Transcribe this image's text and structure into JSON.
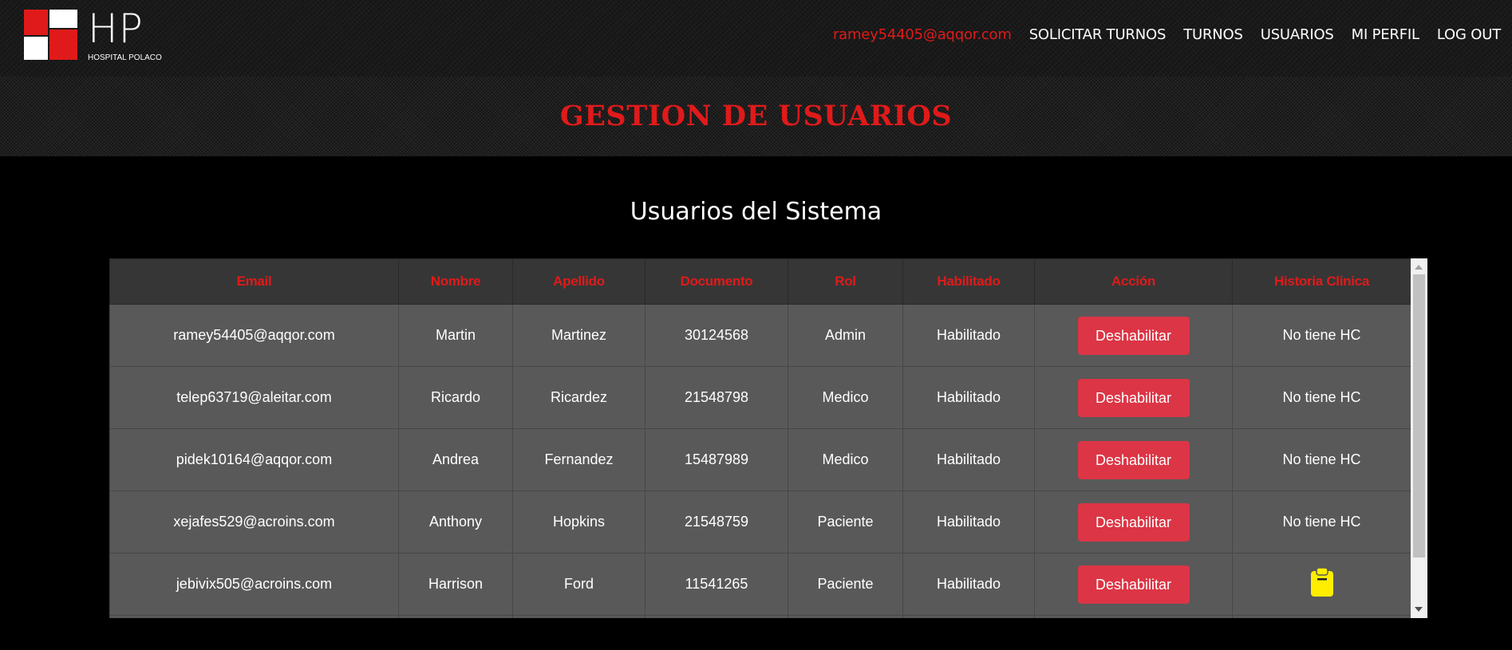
{
  "logo": {
    "letters": "HP",
    "subtitle": "HOSPITAL POLACO",
    "colors": [
      "#e01a1a",
      "#ffffff"
    ]
  },
  "nav": {
    "user_email": "ramey54405@aqqor.com",
    "items": [
      "SOLICITAR TURNOS",
      "TURNOS",
      "USUARIOS",
      "MI PERFIL",
      "LOG OUT"
    ]
  },
  "page_title": "GESTION DE USUARIOS",
  "section_title": "Usuarios del Sistema",
  "table": {
    "headers": [
      "Email",
      "Nombre",
      "Apellido",
      "Documento",
      "Rol",
      "Habilitado",
      "Acción",
      "Historia Clinica"
    ],
    "rows": [
      {
        "email": "ramey54405@aqqor.com",
        "nombre": "Martin",
        "apellido": "Martinez",
        "documento": "30124568",
        "rol": "Admin",
        "habilitado": "Habilitado",
        "accion": "Deshabilitar",
        "historia": "No tiene HC"
      },
      {
        "email": "telep63719@aleitar.com",
        "nombre": "Ricardo",
        "apellido": "Ricardez",
        "documento": "21548798",
        "rol": "Medico",
        "habilitado": "Habilitado",
        "accion": "Deshabilitar",
        "historia": "No tiene HC"
      },
      {
        "email": "pidek10164@aqqor.com",
        "nombre": "Andrea",
        "apellido": "Fernandez",
        "documento": "15487989",
        "rol": "Medico",
        "habilitado": "Habilitado",
        "accion": "Deshabilitar",
        "historia": "No tiene HC"
      },
      {
        "email": "xejafes529@acroins.com",
        "nombre": "Anthony",
        "apellido": "Hopkins",
        "documento": "21548759",
        "rol": "Paciente",
        "habilitado": "Habilitado",
        "accion": "Deshabilitar",
        "historia": "No tiene HC"
      },
      {
        "email": "jebivix505@acroins.com",
        "nombre": "Harrison",
        "apellido": "Ford",
        "documento": "11541265",
        "rol": "Paciente",
        "habilitado": "Habilitado",
        "accion": "Deshabilitar",
        "historia": "",
        "historia_icon": "clipboard-icon"
      }
    ]
  },
  "colors": {
    "accent": "#e01a1a",
    "button": "#dc3545",
    "clipboard": "#ffee00",
    "table_bg": "#595959",
    "header_bg": "#363636"
  }
}
